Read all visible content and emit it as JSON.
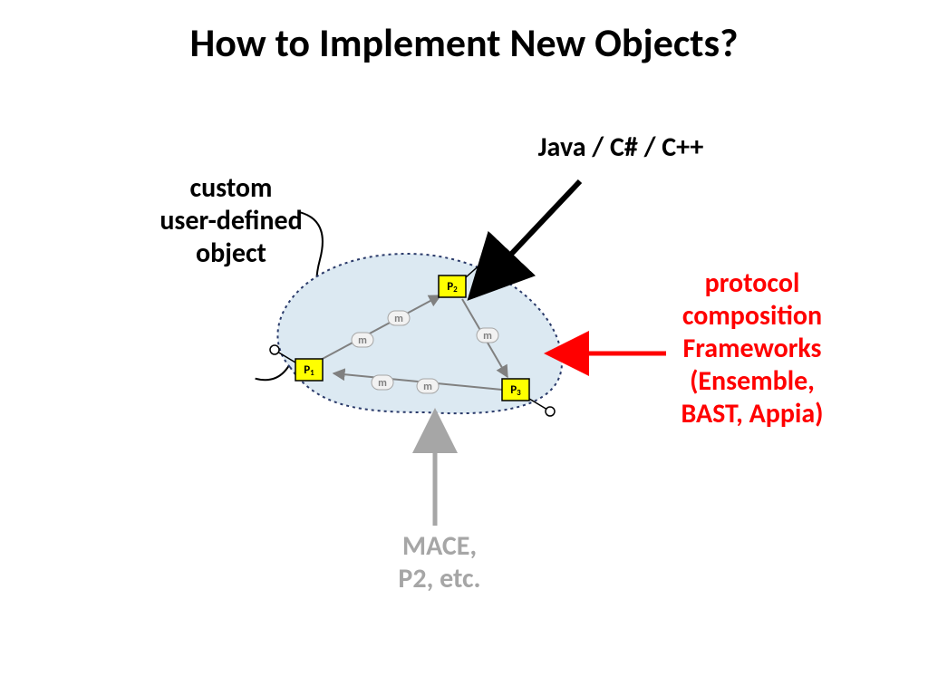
{
  "title": "How to Implement New Objects?",
  "labels": {
    "custom": "custom\nuser-defined\nobject",
    "java": "Java / C# / C++",
    "proto": "protocol\ncomposition\nFrameworks\n(Ensemble,\nBAST, Appia)",
    "mace": "MACE,\nP2, etc."
  },
  "nodes": {
    "p1": "P1",
    "p2": "P2",
    "p3": "P3"
  },
  "msg": "m",
  "colors": {
    "proto_text": "#ff0000",
    "mace_text": "#a6a6a6",
    "blob_fill": "#dce9f2",
    "blob_stroke": "#2a3a6a",
    "node_fill": "#ffff00"
  }
}
